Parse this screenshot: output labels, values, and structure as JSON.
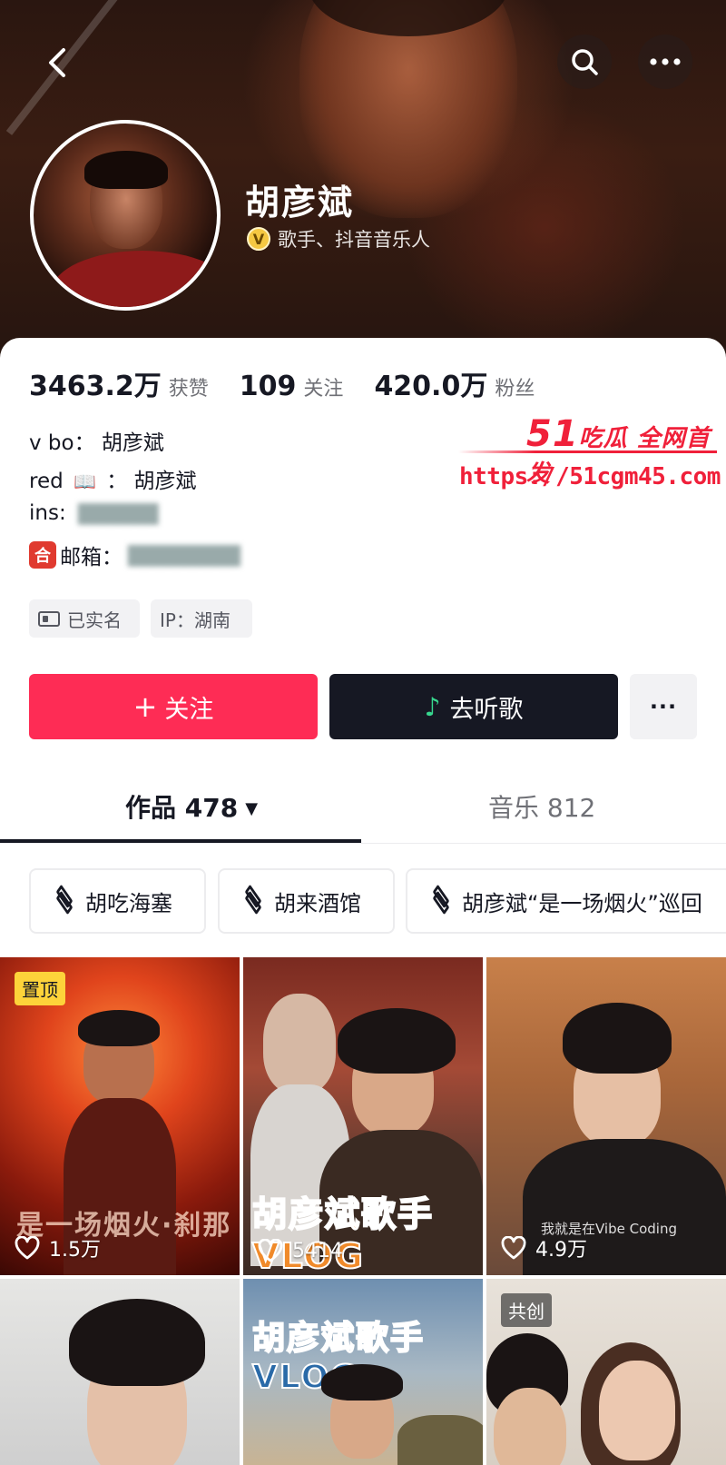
{
  "header": {
    "profile_name": "胡彦斌",
    "verification_text": "歌手、抖音音乐人",
    "verified_badge": "V"
  },
  "stats": [
    {
      "value": "3463.2万",
      "label": "获赞"
    },
    {
      "value": "109",
      "label": "关注"
    },
    {
      "value": "420.0万",
      "label": "粉丝"
    }
  ],
  "bio": {
    "line1": "v bo： 胡彦斌",
    "line2_prefix": "red",
    "line2_icon": "📖",
    "line2_suffix": "： 胡彦斌",
    "line3_prefix": "ins:",
    "line4_badge": "合",
    "line4_prefix": "邮箱："
  },
  "tags": {
    "real_name": "已实名",
    "ip": "IP：湖南"
  },
  "watermark": {
    "line1_num": "51",
    "line1_text": "吃瓜 全网首发",
    "line2": "https://51cgm45.com"
  },
  "actions": {
    "follow_plus": "+",
    "follow_label": "关注",
    "listen_label": "去听歌",
    "more_label": "···"
  },
  "tabs": {
    "works_label": "作品 478",
    "music_label": "音乐 812"
  },
  "collections": [
    {
      "label": "胡吃海塞"
    },
    {
      "label": "胡来酒馆"
    },
    {
      "label": "胡彦斌“是一场烟火”巡回"
    }
  ],
  "videos": [
    {
      "likes": "1.5万",
      "badge": "置顶",
      "overlay": "是一场烟火·刹那"
    },
    {
      "likes": "5414",
      "overlay": "胡彦斌歌手VLOG"
    },
    {
      "likes": "4.9万",
      "overlay": "我就是在Vibe Coding"
    },
    {},
    {
      "overlay": "胡彦斌歌手VLOG"
    },
    {
      "badge": "共创"
    }
  ],
  "colors": {
    "follow_button": "#fe2c55",
    "listen_button": "#161823",
    "pin_badge": "#fdd33a",
    "watermark": "#f0203a"
  },
  "icons": {
    "back": "chevron-left-icon",
    "search": "search-icon",
    "more": "ellipsis-icon",
    "verified": "verified-badge-icon",
    "id_card": "id-card-icon",
    "music_note": "music-note-icon",
    "collection": "layers-icon",
    "like": "heart-icon"
  }
}
